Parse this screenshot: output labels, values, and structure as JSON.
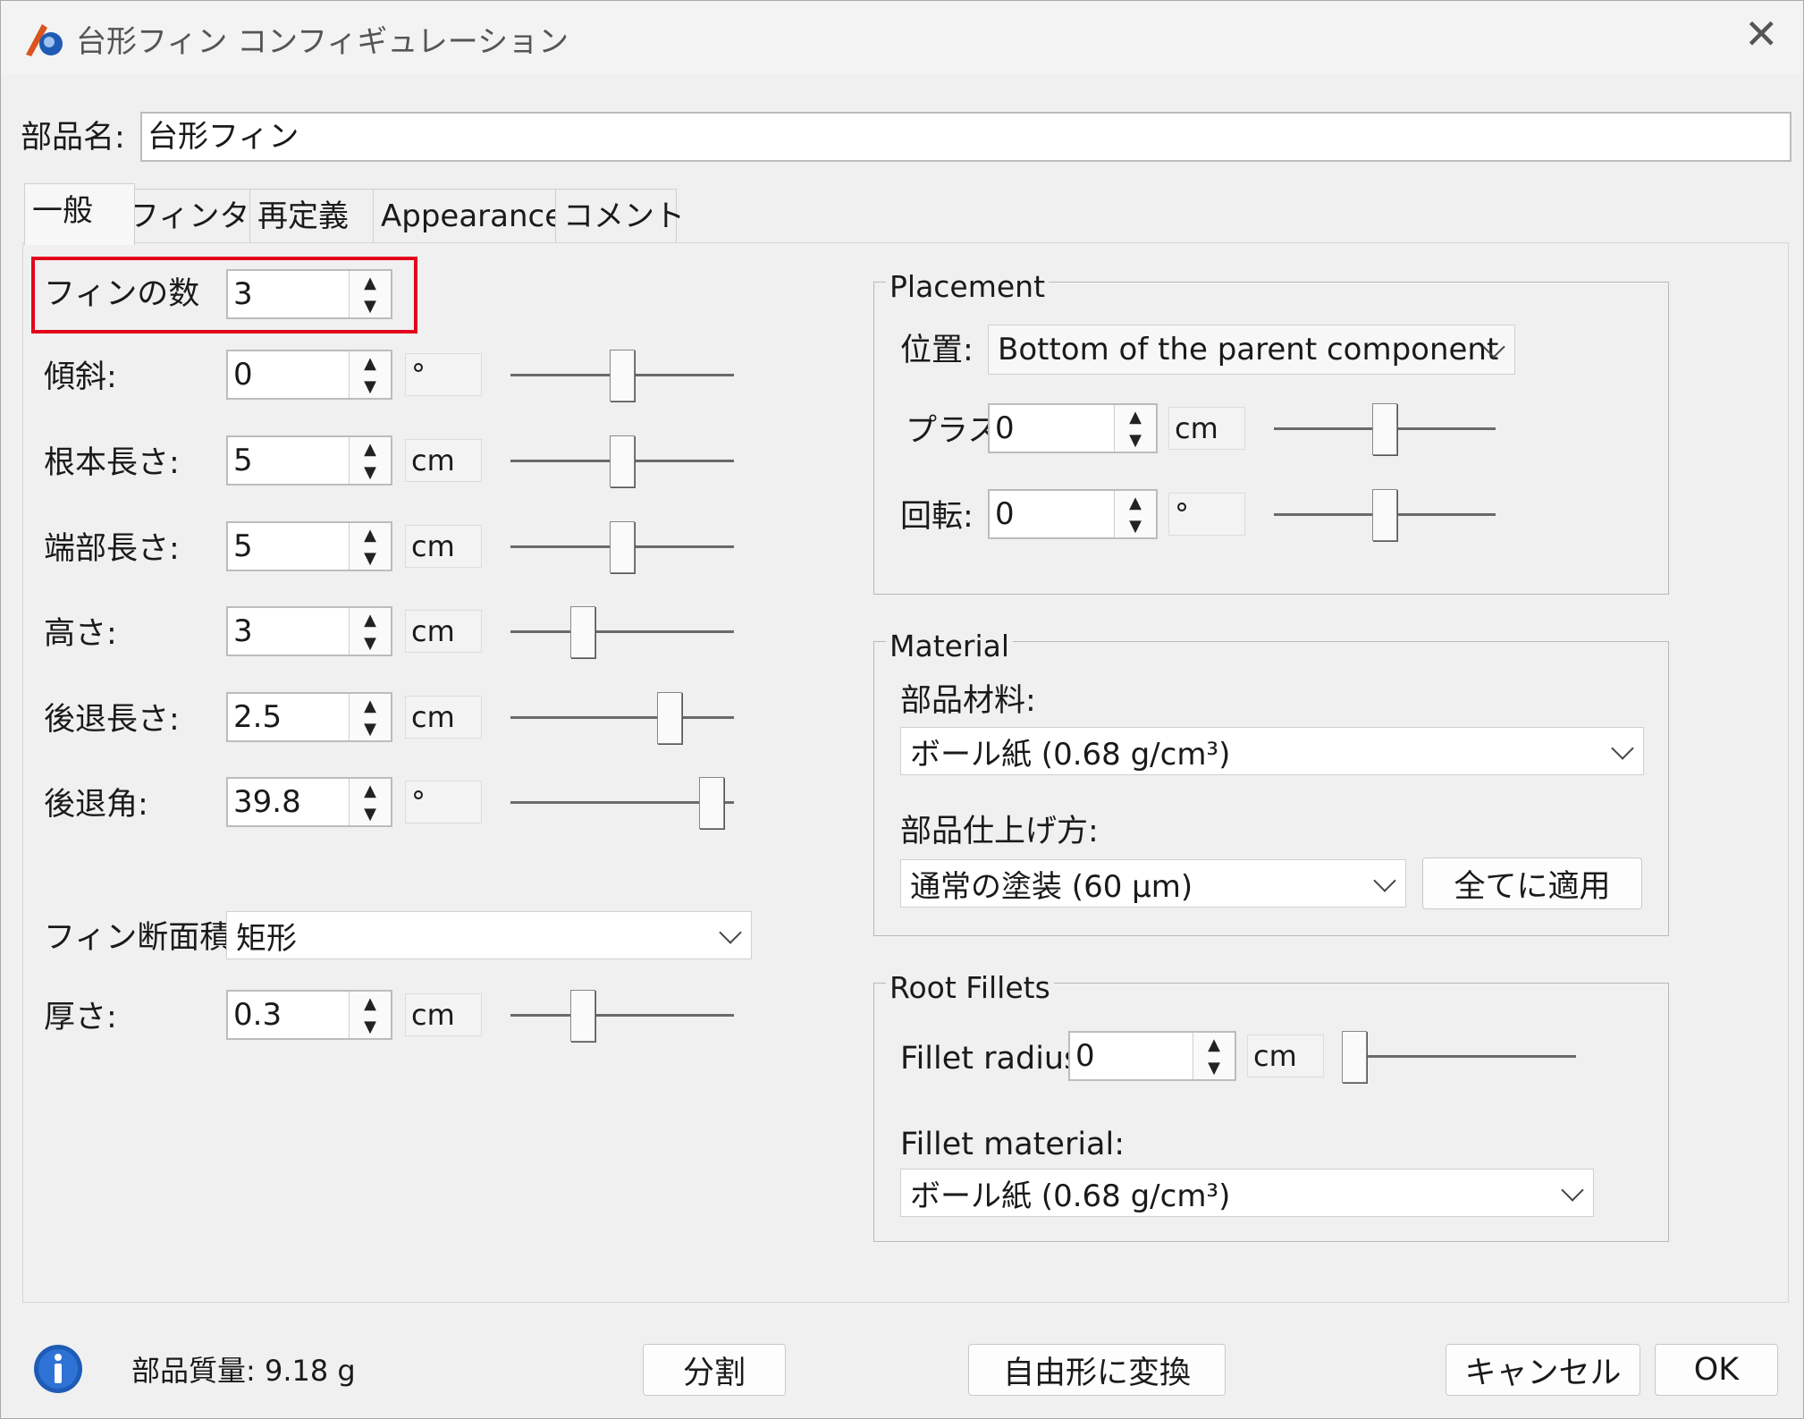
{
  "window": {
    "title": "台形フィン コンフィギュレーション",
    "close_glyph": "✕"
  },
  "name_row": {
    "label": "部品名:",
    "value": "台形フィン"
  },
  "tabs": [
    "一般",
    "フィンタブ",
    "再定義",
    "Appearance",
    "コメント"
  ],
  "left": {
    "fin_count": {
      "label": "フィンの数",
      "value": "3"
    },
    "rows": [
      {
        "label": "傾斜:",
        "value": "0",
        "unit": "°",
        "slider": 0.5
      },
      {
        "label": "根本長さ:",
        "value": "5",
        "unit": "cm",
        "slider": 0.5
      },
      {
        "label": "端部長さ:",
        "value": "5",
        "unit": "cm",
        "slider": 0.5
      },
      {
        "label": "高さ:",
        "value": "3",
        "unit": "cm",
        "slider": 0.3
      },
      {
        "label": "後退長さ:",
        "value": "2.5",
        "unit": "cm",
        "slider": 0.74
      },
      {
        "label": "後退角:",
        "value": "39.8",
        "unit": "°",
        "slider": 0.95
      }
    ],
    "cross_section": {
      "label": "フィン断面積:",
      "value": "矩形"
    },
    "thickness": {
      "label": "厚さ:",
      "value": "0.3",
      "unit": "cm",
      "slider": 0.3
    }
  },
  "placement": {
    "title": "Placement",
    "position_label": "位置:",
    "position_value": "Bottom of the parent component",
    "plus": {
      "label": "プラス",
      "value": "0",
      "unit": "cm",
      "slider": 0.5
    },
    "rotation": {
      "label": "回転:",
      "value": "0",
      "unit": "°",
      "slider": 0.5
    }
  },
  "material": {
    "title": "Material",
    "material_label": "部品材料:",
    "material_value": "ボール紙 (0.68 g/cm³)",
    "finish_label": "部品仕上げ方:",
    "finish_value": "通常の塗装 (60 μm)",
    "apply_all": "全てに適用"
  },
  "root_fillets": {
    "title": "Root Fillets",
    "radius_label": "Fillet radius:",
    "radius_value": "0",
    "radius_unit": "cm",
    "radius_slider": 0.0,
    "material_label": "Fillet material:",
    "material_value": "ボール紙 (0.68 g/cm³)"
  },
  "footer": {
    "info_icon": "info-icon",
    "mass_text": "部品質量: 9.18 g",
    "split_button": "分割",
    "freeform_button": "自由形に変換",
    "cancel_button": "キャンセル",
    "ok_button": "OK"
  },
  "colors": {
    "highlight": "#e3001b",
    "info": "#1e5bb5"
  }
}
